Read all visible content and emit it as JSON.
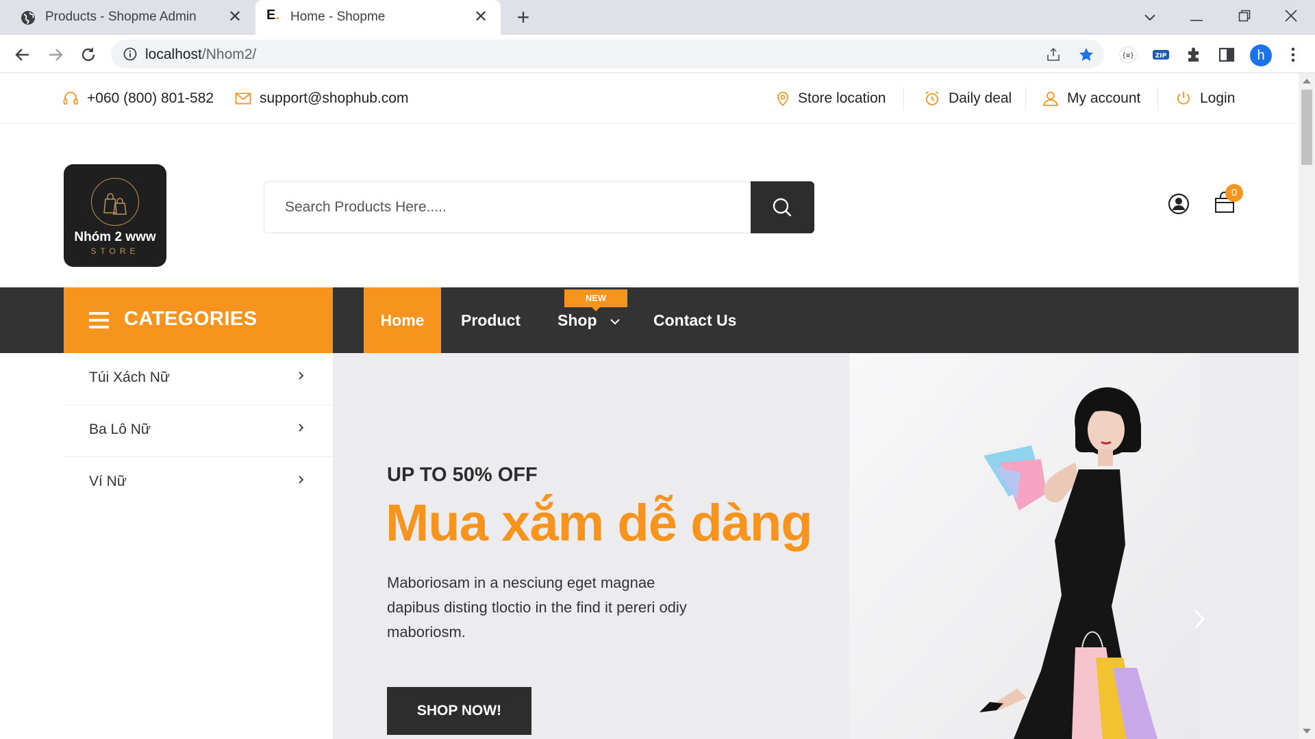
{
  "browser": {
    "tabs": [
      {
        "title": "Products - Shopme Admin",
        "icon": "globe-icon",
        "active": false
      },
      {
        "title": "Home - Shopme",
        "icon": "E.",
        "active": true
      }
    ],
    "url_host": "localhost",
    "url_path": "/Nhom2/",
    "profile_initial": "h"
  },
  "topbar": {
    "phone": "+060 (800) 801-582",
    "email": "support@shophub.com",
    "links": [
      "Store location",
      "Daily deal",
      "My account",
      "Login"
    ]
  },
  "header": {
    "logo_name": "Nhóm 2 www",
    "logo_sub": "STORE",
    "search_placeholder": "Search Products Here.....",
    "cart_count": "0"
  },
  "nav": {
    "categories_label": "CATEGORIES",
    "links": [
      "Home",
      "Product",
      "Shop",
      "Contact Us"
    ],
    "active": "Home",
    "new_badge": "NEW"
  },
  "sidebar": {
    "items": [
      "Túi Xách Nữ",
      "Ba Lô Nữ",
      "Ví Nữ"
    ]
  },
  "hero": {
    "eyebrow": "UP TO 50% OFF",
    "headline": "Mua xắm dễ dàng",
    "description": "Maboriosam in a nesciung eget magnae dapibus disting tloctio in the find it pereri odiy maboriosm.",
    "button": "SHOP NOW!"
  },
  "colors": {
    "accent": "#f7941d",
    "dark": "#333333",
    "hero_bg": "#ececee"
  }
}
